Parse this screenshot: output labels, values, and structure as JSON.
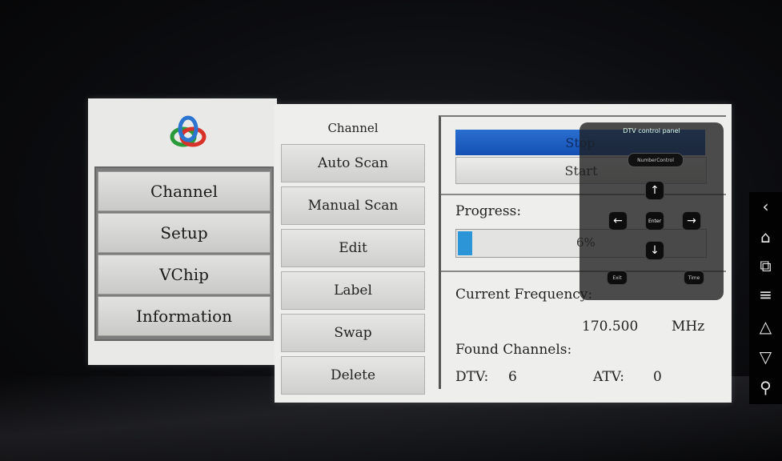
{
  "left_menu": {
    "items": [
      {
        "label": "Channel"
      },
      {
        "label": "Setup"
      },
      {
        "label": "VChip"
      },
      {
        "label": "Information"
      }
    ]
  },
  "channel_menu": {
    "title": "Channel",
    "items": [
      {
        "label": "Auto Scan"
      },
      {
        "label": "Manual Scan"
      },
      {
        "label": "Edit"
      },
      {
        "label": "Label"
      },
      {
        "label": "Swap"
      },
      {
        "label": "Delete"
      }
    ]
  },
  "scan": {
    "stop_label": "Stop",
    "start_label": "Start",
    "progress_label": "Progress:",
    "progress_percent": 6,
    "progress_text": "6%",
    "current_frequency_label": "Current Frequency:",
    "current_frequency_value": "170.500",
    "frequency_unit": "MHz",
    "found_channels_label": "Found Channels:",
    "dtv_label": "DTV:",
    "dtv_count": "6",
    "atv_label": "ATV:",
    "atv_count": "0"
  },
  "dtv_control_panel": {
    "title": "DTV control panel",
    "number_control_label": "NumberControl",
    "enter_label": "Enter",
    "exit_label": "Exit",
    "time_label": "Time",
    "icons": [
      "arrow-up-icon",
      "arrow-down-icon",
      "arrow-left-icon",
      "arrow-right-icon"
    ]
  },
  "side_nav": {
    "icons": [
      "back-icon",
      "home-icon",
      "recent-apps-icon",
      "menu-icon",
      "volume-up-icon",
      "volume-down-icon",
      "search-icon"
    ]
  },
  "colors": {
    "accent_blue": "#1550b3",
    "progress_fill": "#2b95d8"
  }
}
